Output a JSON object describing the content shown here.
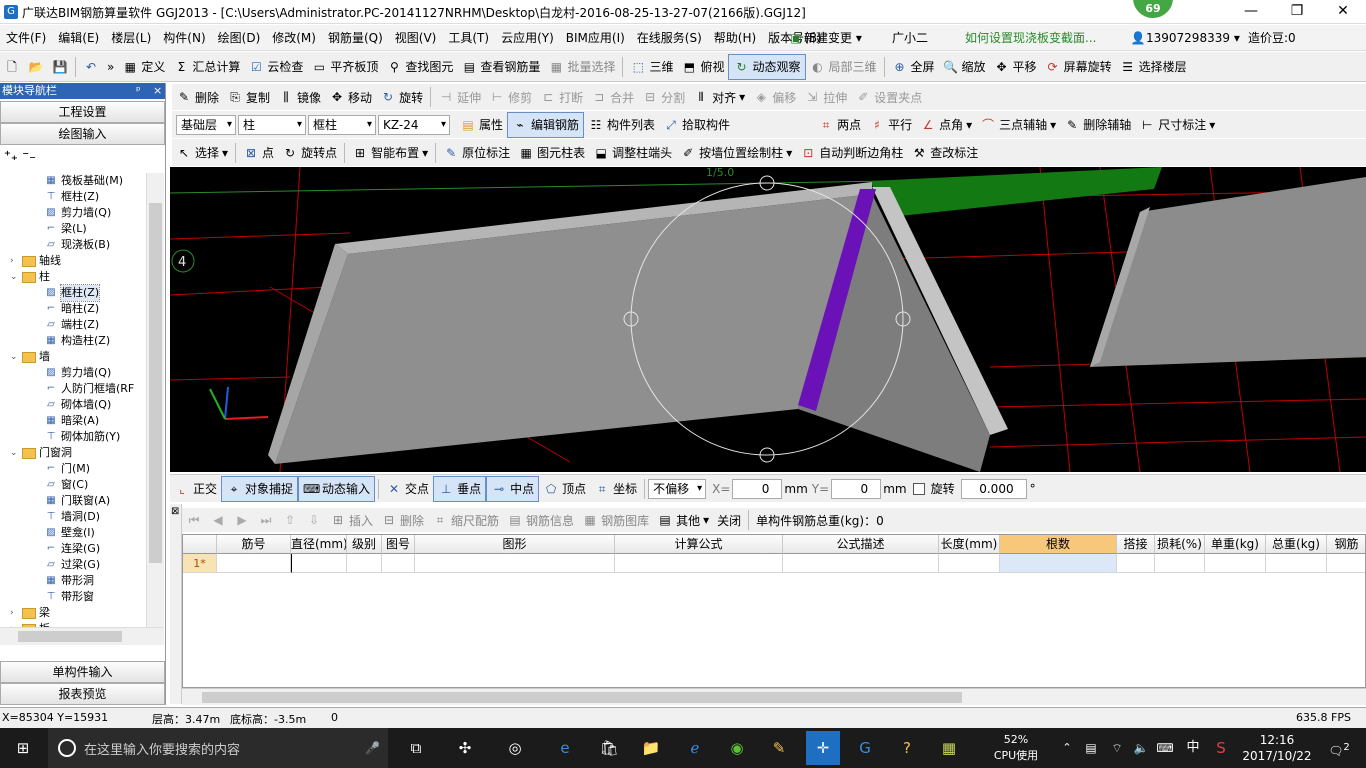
{
  "window": {
    "title": "广联达BIM钢筋算量软件 GGJ2013 - [C:\\Users\\Administrator.PC-20141127NRHM\\Desktop\\白龙村-2016-08-25-13-27-07(2166版).GGJ12]",
    "badge": "69",
    "controls": [
      "—",
      "❐",
      "✕"
    ]
  },
  "menu": {
    "items": [
      "文件(F)",
      "编辑(E)",
      "楼层(L)",
      "构件(N)",
      "绘图(D)",
      "修改(M)",
      "钢筋量(Q)",
      "视图(V)",
      "工具(T)",
      "云应用(Y)",
      "BIM应用(I)",
      "在线服务(S)",
      "帮助(H)",
      "版本号(B)"
    ],
    "new_change": "新建变更",
    "new_change_arrow": "▾",
    "assistant": "广小二",
    "question": "如何设置现浇板变截面...",
    "phone": "13907298339",
    "phone_arrow": "▾",
    "coins": "造价豆:0"
  },
  "toolbar1": {
    "more": "»",
    "items": [
      "定义",
      "汇总计算",
      "云检查",
      "平齐板顶",
      "查找图元",
      "查看钢筋量",
      "批量选择"
    ],
    "view3d": "三维",
    "top_view": "俯视",
    "dynamic": "动态观察",
    "local3d": "局部三维",
    "fullscreen": "全屏",
    "zoom": "缩放",
    "pan": "平移",
    "rotate": "屏幕旋转",
    "floor": "选择楼层"
  },
  "nav": {
    "header": "模块导航栏",
    "pin": "ᵖ",
    "close": "×",
    "btn_project": "工程设置",
    "btn_draw": "绘图输入",
    "btn_single": "单构件输入",
    "btn_report": "报表预览",
    "tree": [
      {
        "label": "筏板基础(M)",
        "level": 2
      },
      {
        "label": "框柱(Z)",
        "level": 2
      },
      {
        "label": "剪力墙(Q)",
        "level": 2
      },
      {
        "label": "梁(L)",
        "level": 2
      },
      {
        "label": "现浇板(B)",
        "level": 2
      },
      {
        "label": "轴线",
        "level": 1,
        "exp": "›"
      },
      {
        "label": "柱",
        "level": 1,
        "exp": "⌄"
      },
      {
        "label": "框柱(Z)",
        "level": 2,
        "selected": true
      },
      {
        "label": "暗柱(Z)",
        "level": 2
      },
      {
        "label": "端柱(Z)",
        "level": 2
      },
      {
        "label": "构造柱(Z)",
        "level": 2
      },
      {
        "label": "墙",
        "level": 1,
        "exp": "⌄"
      },
      {
        "label": "剪力墙(Q)",
        "level": 2
      },
      {
        "label": "人防门框墙(RF",
        "level": 2
      },
      {
        "label": "砌体墙(Q)",
        "level": 2
      },
      {
        "label": "暗梁(A)",
        "level": 2
      },
      {
        "label": "砌体加筋(Y)",
        "level": 2
      },
      {
        "label": "门窗洞",
        "level": 1,
        "exp": "⌄"
      },
      {
        "label": "门(M)",
        "level": 2
      },
      {
        "label": "窗(C)",
        "level": 2
      },
      {
        "label": "门联窗(A)",
        "level": 2
      },
      {
        "label": "墙洞(D)",
        "level": 2
      },
      {
        "label": "壁龛(I)",
        "level": 2
      },
      {
        "label": "连梁(G)",
        "level": 2
      },
      {
        "label": "过梁(G)",
        "level": 2
      },
      {
        "label": "带形洞",
        "level": 2
      },
      {
        "label": "带形窗",
        "level": 2
      },
      {
        "label": "梁",
        "level": 1,
        "exp": "›"
      },
      {
        "label": "板",
        "level": 1,
        "exp": "›"
      }
    ]
  },
  "toolbar2": {
    "items": [
      "删除",
      "复制",
      "镜像",
      "移动",
      "旋转",
      "延伸",
      "修剪",
      "打断",
      "合并",
      "分割",
      "对齐",
      "偏移",
      "拉伸",
      "设置夹点"
    ]
  },
  "toolbar3": {
    "floor": "基础层",
    "category": "柱",
    "type": "框柱",
    "name": "KZ-24",
    "items": [
      "属性",
      "编辑钢筋",
      "构件列表",
      "拾取构件"
    ],
    "aux": [
      "两点",
      "平行",
      "点角",
      "三点辅轴",
      "删除辅轴",
      "尺寸标注"
    ]
  },
  "toolbar4": {
    "items": [
      "选择",
      "点",
      "旋转点",
      "智能布置",
      "原位标注",
      "图元柱表",
      "调整柱端头",
      "按墙位置绘制柱",
      "自动判断边角柱",
      "查改标注"
    ]
  },
  "viewport": {
    "axis_label": "4",
    "top_label": "1/5.0"
  },
  "snapbar": {
    "ortho": "正交",
    "snap": "对象捕捉",
    "dyn": "动态输入",
    "cross": "交点",
    "perp": "垂点",
    "mid": "中点",
    "vertex": "顶点",
    "coord": "坐标",
    "offset": "不偏移",
    "x_label": "X=",
    "x_value": "0",
    "unit": "mm",
    "y_label": "Y=",
    "y_value": "0",
    "rotate": "旋转",
    "rotate_value": "0.000",
    "deg": "°"
  },
  "tabletb": {
    "insert": "插入",
    "delete": "删除",
    "scale": "缩尺配筋",
    "info": "钢筋信息",
    "lib": "钢筋图库",
    "other": "其他",
    "close": "关闭",
    "total": "单构件钢筋总重(kg)：0"
  },
  "grid": {
    "columns": [
      "筋号",
      "直径(mm)",
      "级别",
      "图号",
      "图形",
      "计算公式",
      "公式描述",
      "长度(mm)",
      "根数",
      "搭接",
      "损耗(%)",
      "单重(kg)",
      "总重(kg)",
      "钢筋"
    ],
    "row_label": "1*"
  },
  "status": {
    "coords": "X=85304 Y=15931",
    "floor_height": "层高：3.47m",
    "base_height": "底标高：-3.5m",
    "zero": "0",
    "fps": "635.8 FPS"
  },
  "taskbar": {
    "search": "在这里输入你要搜索的内容",
    "cpu_pct": "52%",
    "cpu_label": "CPU使用",
    "ime": "中",
    "time": "12:16",
    "date": "2017/10/22",
    "notif": "2"
  }
}
